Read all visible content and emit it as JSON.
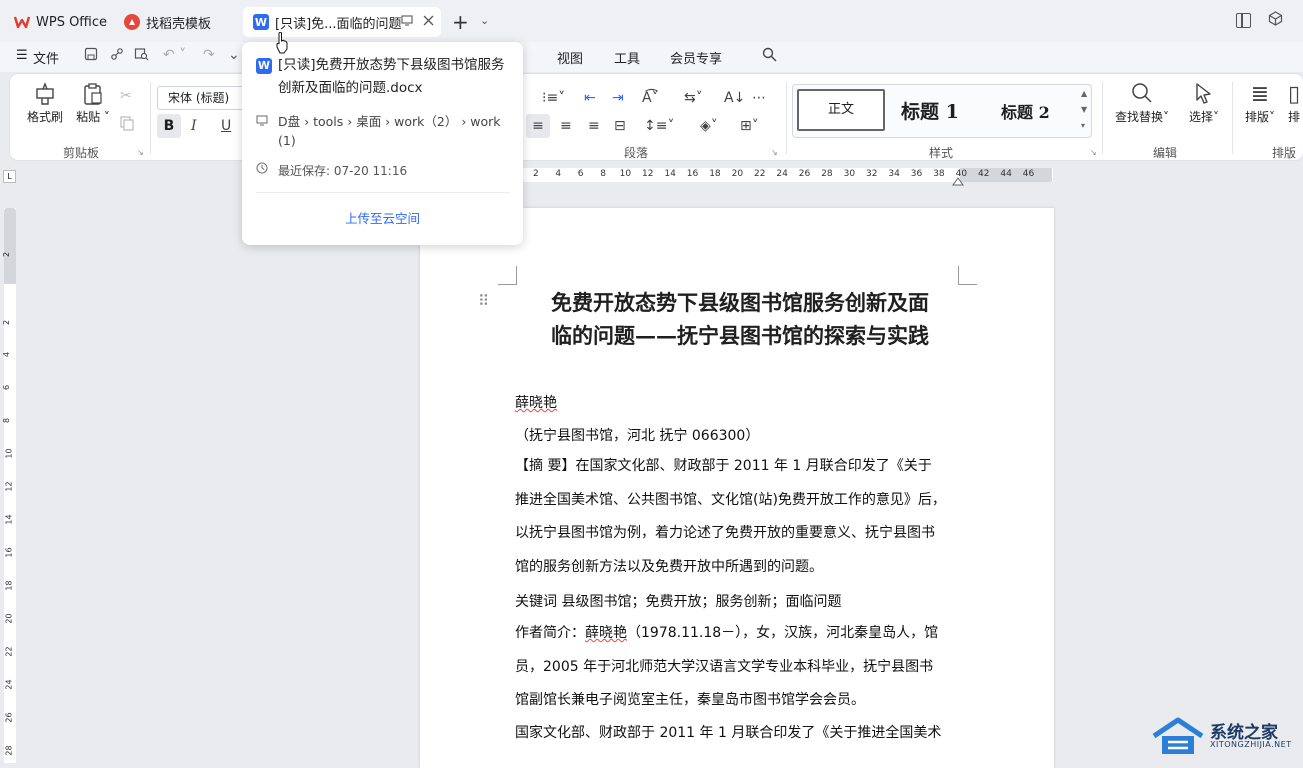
{
  "tabs": [
    {
      "label": "WPS Office",
      "logo": "W"
    },
    {
      "label": "找稻壳模板",
      "logo": "D"
    },
    {
      "label": "[只读]免...面临的问题",
      "logo": "W"
    }
  ],
  "menu": {
    "file": "文件",
    "items": [
      "视图",
      "工具",
      "会员专享"
    ]
  },
  "ribbon": {
    "format_painter": "格式刷",
    "paste": "粘贴",
    "clipboard_group": "剪贴板",
    "font_name": "宋体 (标题)",
    "bold": "B",
    "italic": "I",
    "underline": "U",
    "paragraph_group": "段落",
    "styles": {
      "normal": "正文",
      "h1": "标题 1",
      "h2": "标题 2"
    },
    "styles_group": "样式",
    "find_replace": "查找替换",
    "select": "选择",
    "edit_group": "编辑",
    "arrange": "排版",
    "arrange_short": "排",
    "arrange_group": "排版"
  },
  "ruler": {
    "h": [
      "2",
      "4",
      "6",
      "8",
      "10",
      "12",
      "14",
      "16",
      "18",
      "20",
      "22",
      "24",
      "26",
      "28",
      "30",
      "32",
      "34",
      "36",
      "38",
      "40",
      "42",
      "44",
      "46"
    ],
    "v": [
      "2",
      "2",
      "4",
      "6",
      "8",
      "10",
      "12",
      "14",
      "16",
      "18",
      "20",
      "22",
      "24",
      "26",
      "28"
    ]
  },
  "popup": {
    "filename": "[只读]免费开放态势下县级图书馆服务创新及面临的问题.docx",
    "path": "D盘 › tools › 桌面 › work（2） › work (1)",
    "saved": "最近保存: 07-20 11:16",
    "upload": "上传至云空间"
  },
  "doc": {
    "title_line1": "免费开放态势下县级图书馆服务创新及面",
    "title_line2": "临的问题——抚宁县图书馆的探索与实践",
    "author": "薛晓艳",
    "affiliation": "（抚宁县图书馆，河北  抚宁  066300）",
    "abstract": [
      "【摘    要】在国家文化部、财政部于 2011 年 1 月联合印发了《关于",
      "推进全国美术馆、公共图书馆、文化馆(站)免费开放工作的意见》后，",
      "以抚宁县图书馆为例，着力论述了免费开放的重要意义、抚宁县图书",
      "馆的服务创新方法以及免费开放中所遇到的问题。"
    ],
    "keywords": "关键词     县级图书馆；免费开放；服务创新；面临问题",
    "bio_prefix": "作者简介：",
    "bio_name": "薛晓艳",
    "bio_rest": "（1978.11.18－），女，汉族，河北秦皇岛人，馆",
    "bio_lines": [
      "员，2005 年于河北师范大学汉语言文学专业本科毕业，抚宁县图书",
      "馆副馆长兼电子阅览室主任，秦皇岛市图书馆学会会员。"
    ],
    "body_line": "国家文化部、财政部于 2011 年 1 月联合印发了《关于推进全国美术"
  },
  "watermark": {
    "name": "系统之家",
    "url": "XITONGZHIJIA.NET"
  }
}
